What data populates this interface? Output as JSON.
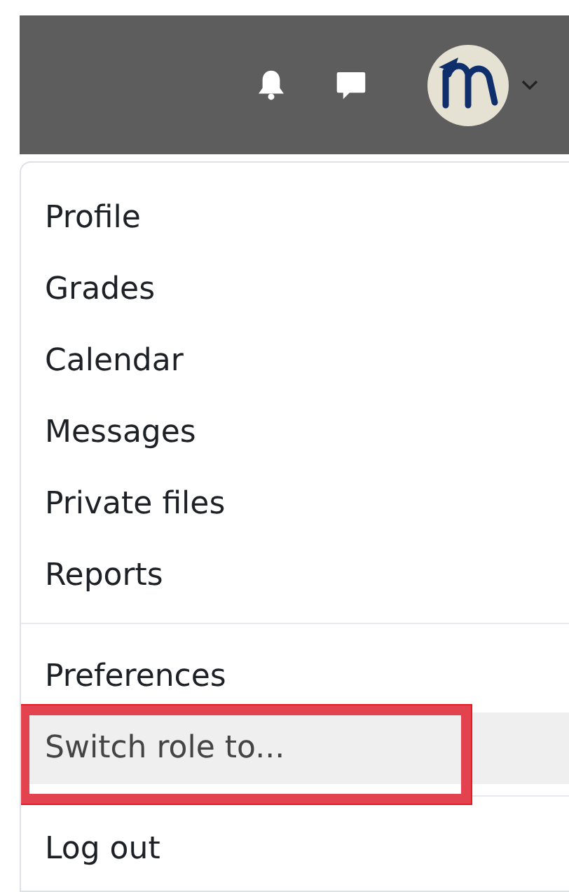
{
  "navbar": {
    "notifications": {
      "kind": "bell"
    },
    "messages": {
      "kind": "chat"
    },
    "user_menu": {
      "expanded": true
    }
  },
  "user_menu": {
    "groups": [
      {
        "items": [
          {
            "label": "Profile",
            "highlighted": false,
            "outlined": false
          },
          {
            "label": "Grades",
            "highlighted": false,
            "outlined": false
          },
          {
            "label": "Calendar",
            "highlighted": false,
            "outlined": false
          },
          {
            "label": "Messages",
            "highlighted": false,
            "outlined": false
          },
          {
            "label": "Private files",
            "highlighted": false,
            "outlined": false
          },
          {
            "label": "Reports",
            "highlighted": false,
            "outlined": false
          }
        ]
      },
      {
        "items": [
          {
            "label": "Preferences",
            "highlighted": false,
            "outlined": false
          },
          {
            "label": "Switch role to...",
            "highlighted": true,
            "outlined": true
          }
        ]
      },
      {
        "items": [
          {
            "label": "Log out",
            "highlighted": false,
            "outlined": false
          }
        ]
      }
    ]
  }
}
